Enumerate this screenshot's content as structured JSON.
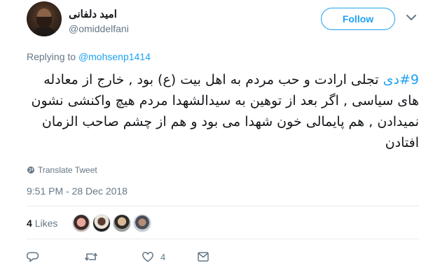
{
  "user": {
    "display_name": "امید دلفانی",
    "handle": "@omiddelfani"
  },
  "follow_button": {
    "label": "Follow"
  },
  "reply": {
    "prefix": "Replying to",
    "target": "@mohsenp1414"
  },
  "tweet": {
    "hashtag": "#9دی",
    "text": " تجلی ارادت و حب مردم به اهل بیت (ع) بود , خارج از معادله های سیاسی , اگر بعد از توهین به سیدالشهدا مردم هیچ واکنشی نشون نمیدادن , هم پایمالی خون شهدا می بود و هم از چشم صاحب الزمان افتادن"
  },
  "translate": {
    "label": "Translate Tweet"
  },
  "timestamp": "9:51 PM - 28 Dec 2018",
  "stats": {
    "likes_count": "4",
    "likes_label": "Likes"
  },
  "actions": {
    "like_count": "4"
  },
  "colors": {
    "accent": "#1da1f2",
    "muted": "#657786",
    "text": "#14171a",
    "divider": "#e6ecf0"
  },
  "icons": [
    "chevron-down-icon",
    "globe-icon",
    "reply-icon",
    "retweet-icon",
    "heart-icon",
    "message-icon"
  ]
}
